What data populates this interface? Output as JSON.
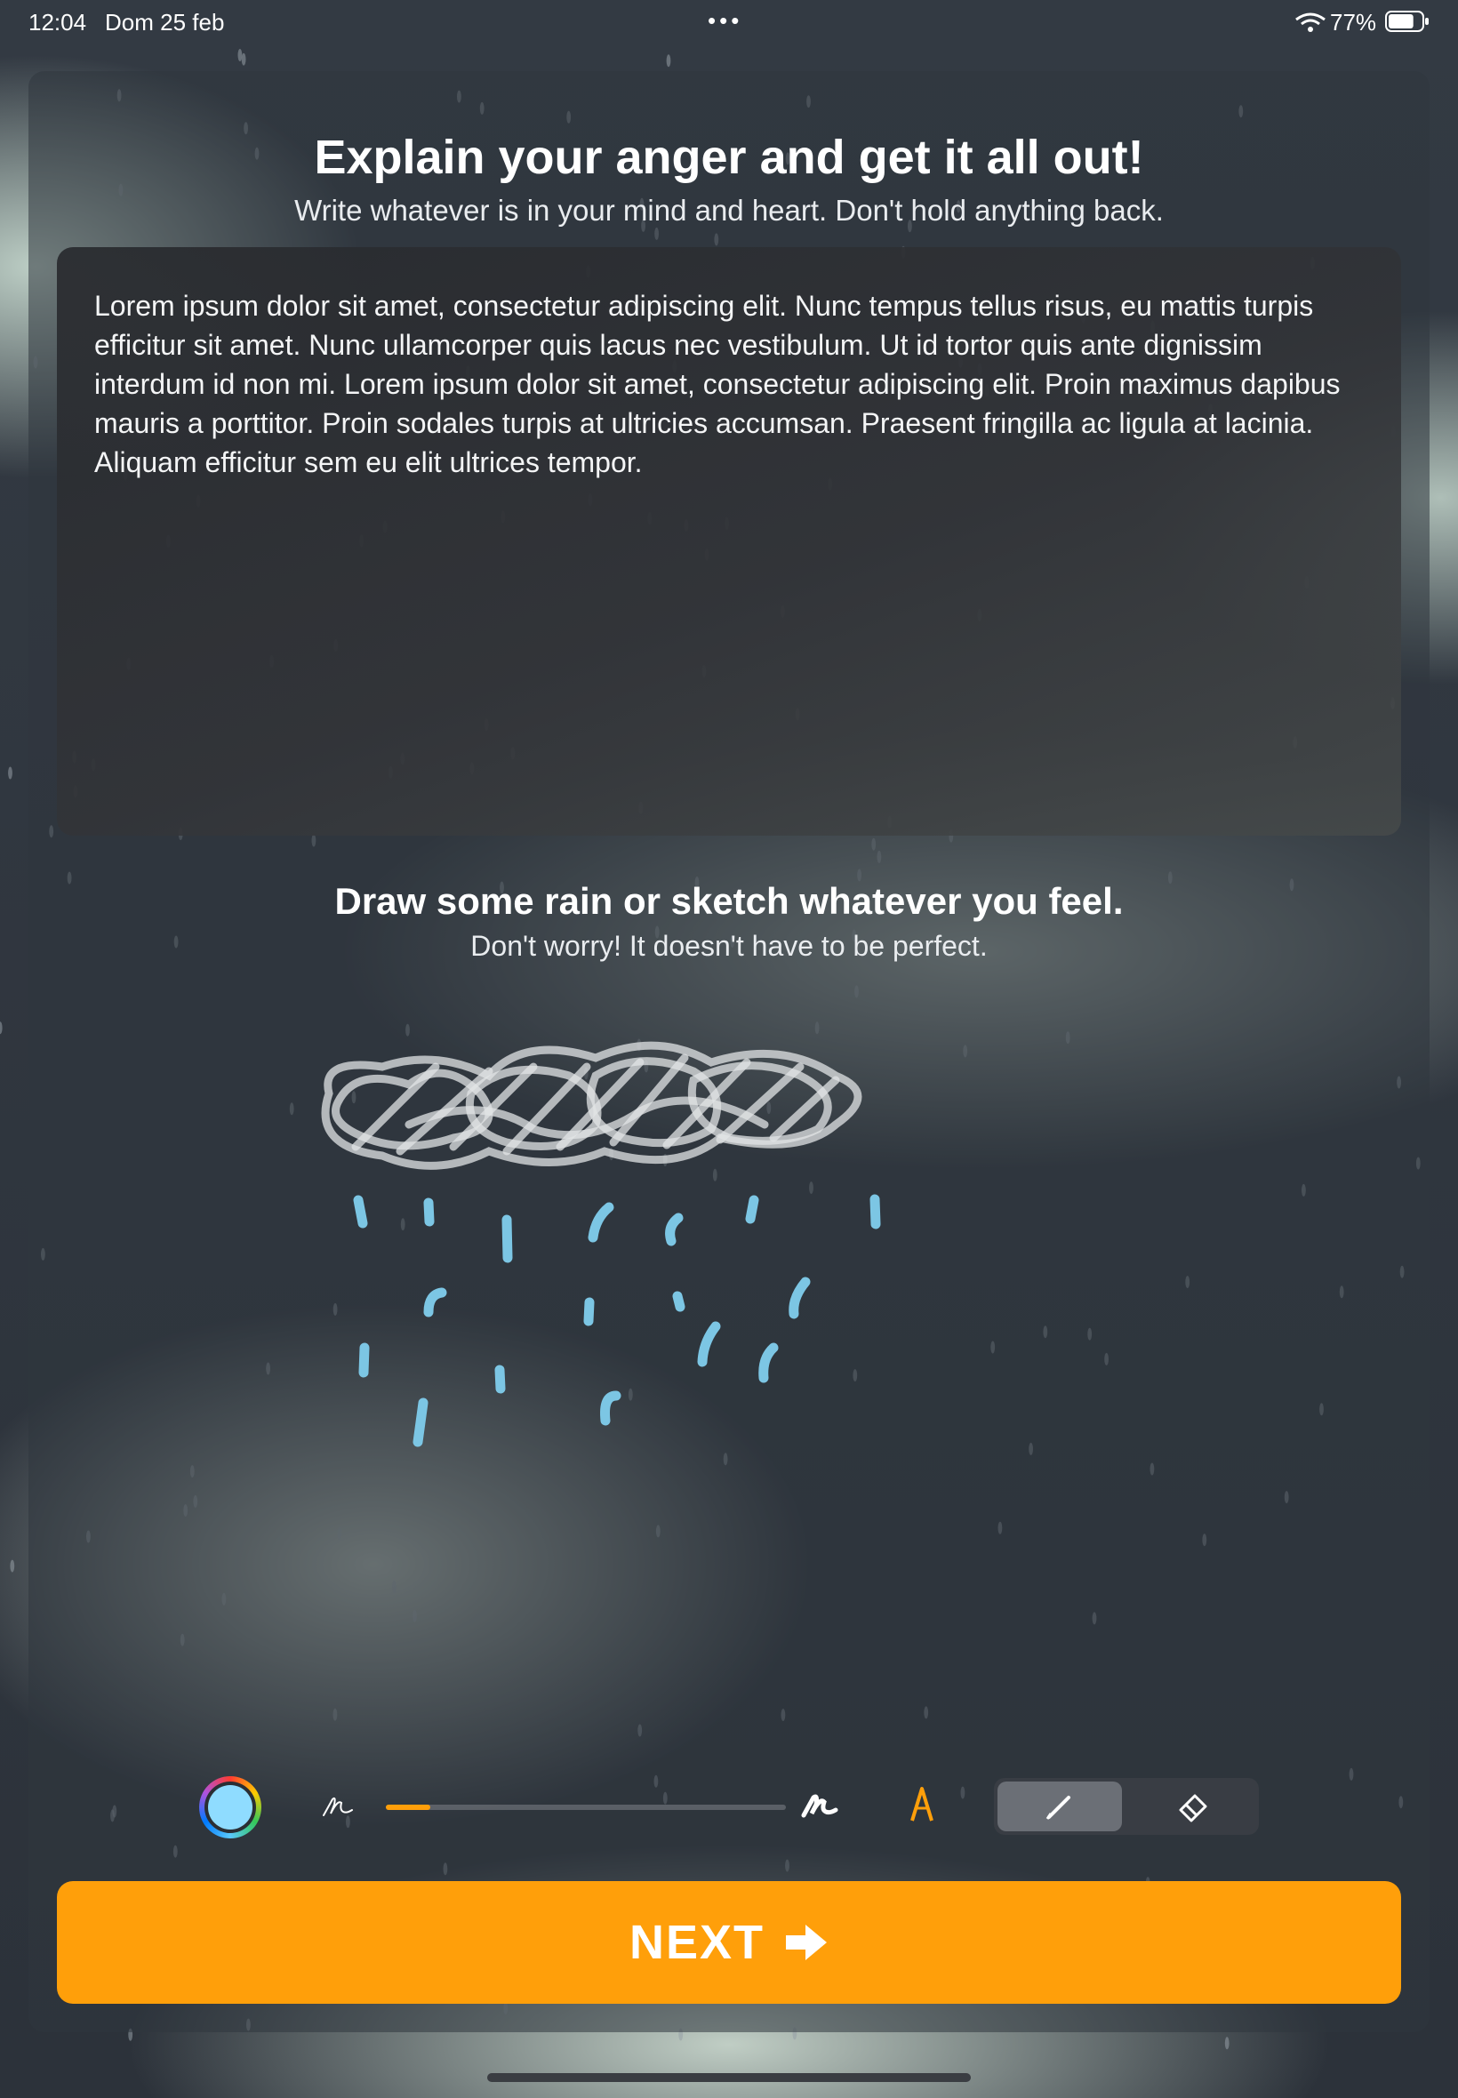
{
  "status_bar": {
    "time": "12:04",
    "date": "Dom 25 feb",
    "battery_percent": "77%",
    "battery_level": 0.77
  },
  "writing": {
    "title": "Explain your anger and get it all out!",
    "subtitle": "Write whatever is in your mind and heart. Don't hold anything back.",
    "body_text": "Lorem ipsum dolor sit amet, consectetur adipiscing elit. Nunc tempus tellus risus, eu mattis turpis efficitur sit amet. Nunc ullamcorper quis lacus nec vestibulum. Ut id tortor quis ante dignissim interdum id non mi. Lorem ipsum dolor sit amet, consectetur adipiscing elit. Proin maximus dapibus mauris a porttitor. Proin sodales turpis at ultricies accumsan. Praesent fringilla ac ligula at lacinia. Aliquam efficitur sem eu elit ultrices tempor."
  },
  "drawing": {
    "title": "Draw some rain or sketch whatever you feel.",
    "subtitle": "Don't worry! It doesn't have to be perfect."
  },
  "toolbar": {
    "selected_color": "#8fdcff",
    "stroke_width_level": 0.11,
    "selected_tool": "pencil",
    "accent_color": "#ff9f0a",
    "icons": [
      "color-picker-icon",
      "thin-stroke-icon",
      "thick-stroke-icon",
      "pencil-tip-icon",
      "pencil-icon",
      "eraser-icon"
    ]
  },
  "next_button": {
    "label": "NEXT",
    "icon": "arrow-right-icon",
    "color": "#ff9f0a"
  }
}
